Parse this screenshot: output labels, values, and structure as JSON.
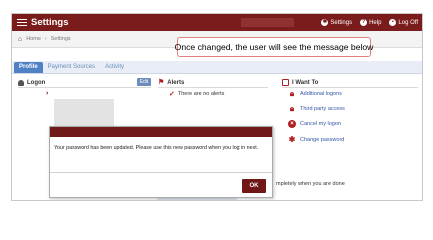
{
  "header": {
    "title": "Settings",
    "nav": [
      {
        "label": "Settings",
        "icon": "gear-icon"
      },
      {
        "label": "Help",
        "icon": "help-icon"
      },
      {
        "label": "Log Off",
        "icon": "lock-icon"
      }
    ]
  },
  "breadcrumb": {
    "home": "Home",
    "current": "Settings"
  },
  "callout": {
    "text": "Once changed, the user will see the message below"
  },
  "tabs": [
    {
      "label": "Profile",
      "active": true
    },
    {
      "label": "Payment Sources",
      "active": false
    },
    {
      "label": "Activity",
      "active": false
    }
  ],
  "columns": {
    "logon": {
      "title": "Logon",
      "edit_label": "Edit"
    },
    "alerts": {
      "title": "Alerts",
      "empty_message": "There are no alerts"
    },
    "i_want_to": {
      "title": "I Want To",
      "links": [
        {
          "label": "Additional logons",
          "icon": "lock-icon"
        },
        {
          "label": "Third party access",
          "icon": "lock-icon"
        },
        {
          "label": "Cancel my logon",
          "icon": "cancel-icon"
        },
        {
          "label": "Change password",
          "icon": "gear-icon"
        }
      ]
    }
  },
  "bottom_text": "mpletely when you are done",
  "dialog": {
    "message": "Your password has been updated. Please use this new password when you log in next.",
    "ok_label": "OK"
  },
  "colors": {
    "brand": "#7a1c1c",
    "tab_active": "#4f81c4",
    "link": "#3456a8",
    "callout_border": "#e28080"
  }
}
